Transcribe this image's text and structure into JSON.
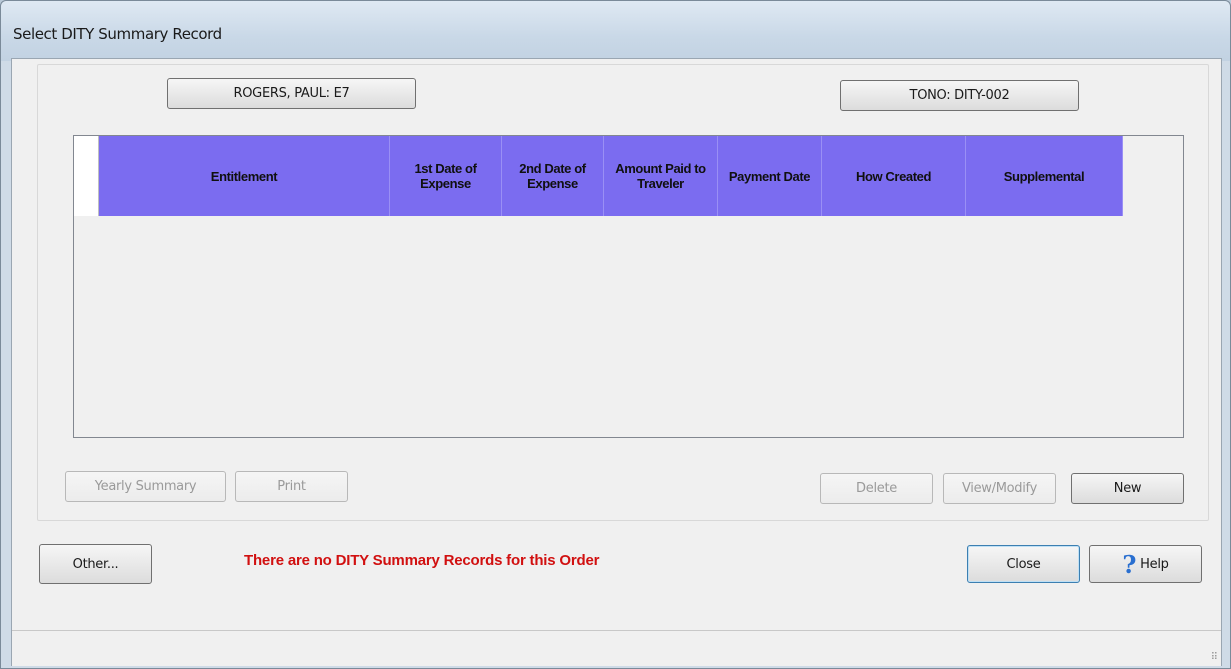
{
  "window": {
    "title": "Select DITY Summary Record"
  },
  "header_buttons": {
    "traveler": "ROGERS, PAUL: E7",
    "tono": "TONO: DITY-002"
  },
  "grid": {
    "columns": [
      {
        "key": "entitlement",
        "label": "Entitlement"
      },
      {
        "key": "first_date",
        "label": "1st Date of Expense"
      },
      {
        "key": "second_date",
        "label": "2nd Date of Expense"
      },
      {
        "key": "amount_paid",
        "label": "Amount Paid to Traveler"
      },
      {
        "key": "payment_date",
        "label": "Payment Date"
      },
      {
        "key": "how_created",
        "label": "How Created"
      },
      {
        "key": "supplemental",
        "label": "Supplemental"
      }
    ],
    "rows": [],
    "header_color": "#7b6cf0"
  },
  "buttons": {
    "yearly_summary": "Yearly Summary",
    "print": "Print",
    "delete": "Delete",
    "view_modify": "View/Modify",
    "new": "New",
    "other": "Other...",
    "close": "Close",
    "help": "Help"
  },
  "message": {
    "text": "There are no DITY Summary Records for this Order",
    "color": "#d11010"
  },
  "icons": {
    "help": "question-mark-icon",
    "grip": "resize-grip-icon"
  }
}
